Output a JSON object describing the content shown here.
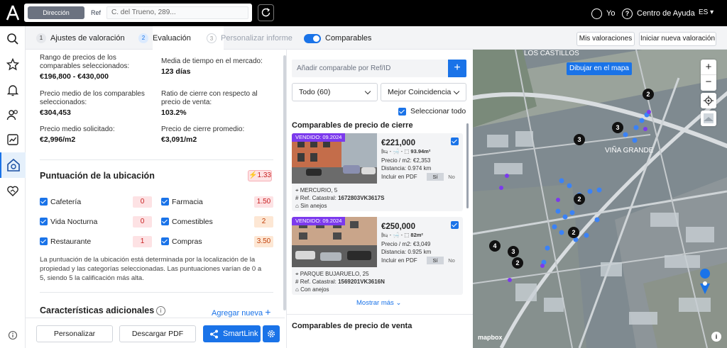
{
  "topbar": {
    "search_mode_active": "Dirección",
    "search_mode_other": "Ref",
    "address_value": "C. del Trueno, 289...",
    "user_label": "Yo",
    "help_label": "Centro de Ayuda",
    "language": "ES"
  },
  "subnav": {
    "steps": [
      {
        "num": "1",
        "label": "Ajustes de valoración"
      },
      {
        "num": "2",
        "label": "Evaluación"
      },
      {
        "num": "3",
        "label": "Personalizar informe"
      }
    ],
    "toggle_label": "Comparables",
    "my_valuations": "Mis valoraciones",
    "new_valuation": "Iniciar nueva valoración"
  },
  "stats": {
    "range_label": "Rango de precios de los comparables seleccionados:",
    "range_value": "€196,800 - €430,000",
    "market_time_label": "Media de tiempo en el mercado:",
    "market_time_value": "123 días",
    "avg_price_label": "Precio medio de los comparables seleccionados:",
    "avg_price_value": "€304,453",
    "close_ratio_label": "Ratio de cierre con respecto al precio de venta:",
    "close_ratio_value": "103.2%",
    "asked_label": "Precio medio solicitado:",
    "asked_value": "€2,996/m2",
    "closing_label": "Precio de cierre promedio:",
    "closing_value": "€3,091/m2"
  },
  "location": {
    "title": "Puntuación de la ubicación",
    "badge": "1.33",
    "categories": [
      {
        "label": "Cafetería",
        "score": "0"
      },
      {
        "label": "Farmacia",
        "score": "1.50"
      },
      {
        "label": "Vida Nocturna",
        "score": "0"
      },
      {
        "label": "Comestibles",
        "score": "2"
      },
      {
        "label": "Restaurante",
        "score": "1"
      },
      {
        "label": "Compras",
        "score": "3.50"
      }
    ],
    "note": "La puntuación de la ubicación está determinada por la localización de la propiedad y las categorías seleccionadas. Las puntuaciones varían de 0 a 5, siendo 5 la calificación más alta."
  },
  "extras": {
    "title": "Características adicionales",
    "add_label": "Agregar nueva"
  },
  "bottom": {
    "personalize": "Personalizar",
    "download_pdf": "Descargar PDF",
    "smartlink": "SmartLink"
  },
  "comparables": {
    "add_placeholder": "Añadir comparable por Ref/ID",
    "filter_all": "Todo (60)",
    "filter_sort": "Mejor Coincidencia",
    "select_all": "Seleccionar todo",
    "section_close": "Comparables de precio de cierre",
    "section_sale": "Comparables de precio de venta",
    "show_more": "Mostrar más",
    "cards": [
      {
        "sold": "VENDIDO: 09.2024",
        "price": "€221,000",
        "area": "93.94m²",
        "price_m2": "Precio / m2: €2,353",
        "distance": "Distancia: 0.974 km",
        "pdf_label": "Incluir en PDF",
        "yes": "Sí",
        "no": "No",
        "street": "MERCURIO, 5",
        "cadastral_prefix": "Ref. Catastral:",
        "cadastral": "1672803VK3617S",
        "annex": "Sin anejos"
      },
      {
        "sold": "VENDIDO: 09.2024",
        "price": "€250,000",
        "area": "82m²",
        "price_m2": "Precio / m2: €3,049",
        "distance": "Distancia: 0.925 km",
        "pdf_label": "Incluir en PDF",
        "yes": "Sí",
        "no": "No",
        "street": "PARQUE BUJARUELO, 25",
        "cadastral_prefix": "Ref. Catastral:",
        "cadastral": "1569201VK3616N",
        "annex": "Con anejos"
      }
    ]
  },
  "map": {
    "draw_button": "Dibujar en el mapa",
    "place_1": "LOS CASTILLOS",
    "place_2": "VIÑA GRANDE",
    "attribution": "mapbox",
    "clusters": [
      "2",
      "3",
      "3",
      "2",
      "2",
      "4",
      "3",
      "2"
    ],
    "colors": {
      "accent": "#1a73e8",
      "pin": "#3b82f6",
      "purple": "#7c3aed"
    }
  }
}
